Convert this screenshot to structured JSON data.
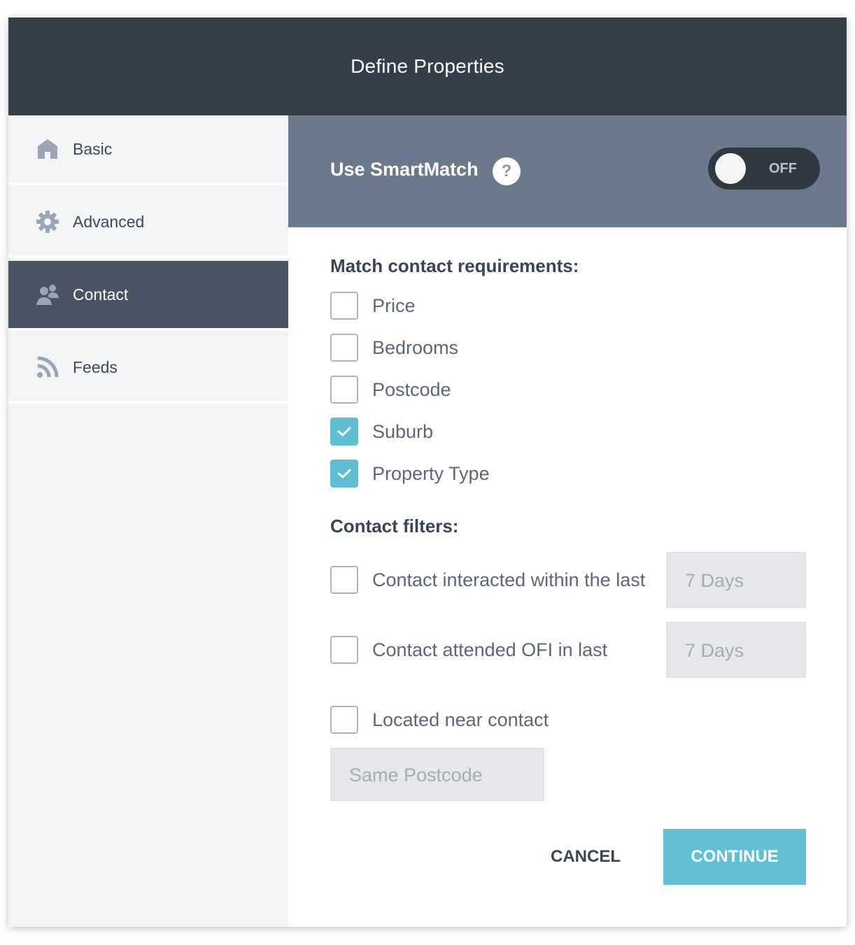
{
  "dialog": {
    "title": "Define Properties"
  },
  "sidebar": {
    "items": [
      {
        "label": "Basic",
        "icon": "home-icon",
        "active": false
      },
      {
        "label": "Advanced",
        "icon": "gear-icon",
        "active": false
      },
      {
        "label": "Contact",
        "icon": "contact-icon",
        "active": true
      },
      {
        "label": "Feeds",
        "icon": "rss-icon",
        "active": false
      }
    ]
  },
  "smartmatch": {
    "label": "Use SmartMatch",
    "help": "?",
    "toggle_state": "OFF"
  },
  "requirements": {
    "title": "Match contact requirements:",
    "items": [
      {
        "label": "Price",
        "checked": false
      },
      {
        "label": "Bedrooms",
        "checked": false
      },
      {
        "label": "Postcode",
        "checked": false
      },
      {
        "label": "Suburb",
        "checked": true
      },
      {
        "label": "Property Type",
        "checked": true
      }
    ]
  },
  "filters": {
    "title": "Contact filters:",
    "interacted": {
      "label": "Contact interacted within the last",
      "checked": false,
      "value": "7 Days"
    },
    "ofi": {
      "label": "Contact attended OFI in last",
      "checked": false,
      "value": "7 Days"
    },
    "near": {
      "label": "Located near contact",
      "checked": false,
      "value": "Same Postcode"
    }
  },
  "actions": {
    "cancel": "CANCEL",
    "continue": "CONTINUE"
  },
  "colors": {
    "header": "#353e4b",
    "accent": "#5fbfd2",
    "smartmatch_bar": "#6b798c",
    "active_nav": "#4a5362"
  }
}
